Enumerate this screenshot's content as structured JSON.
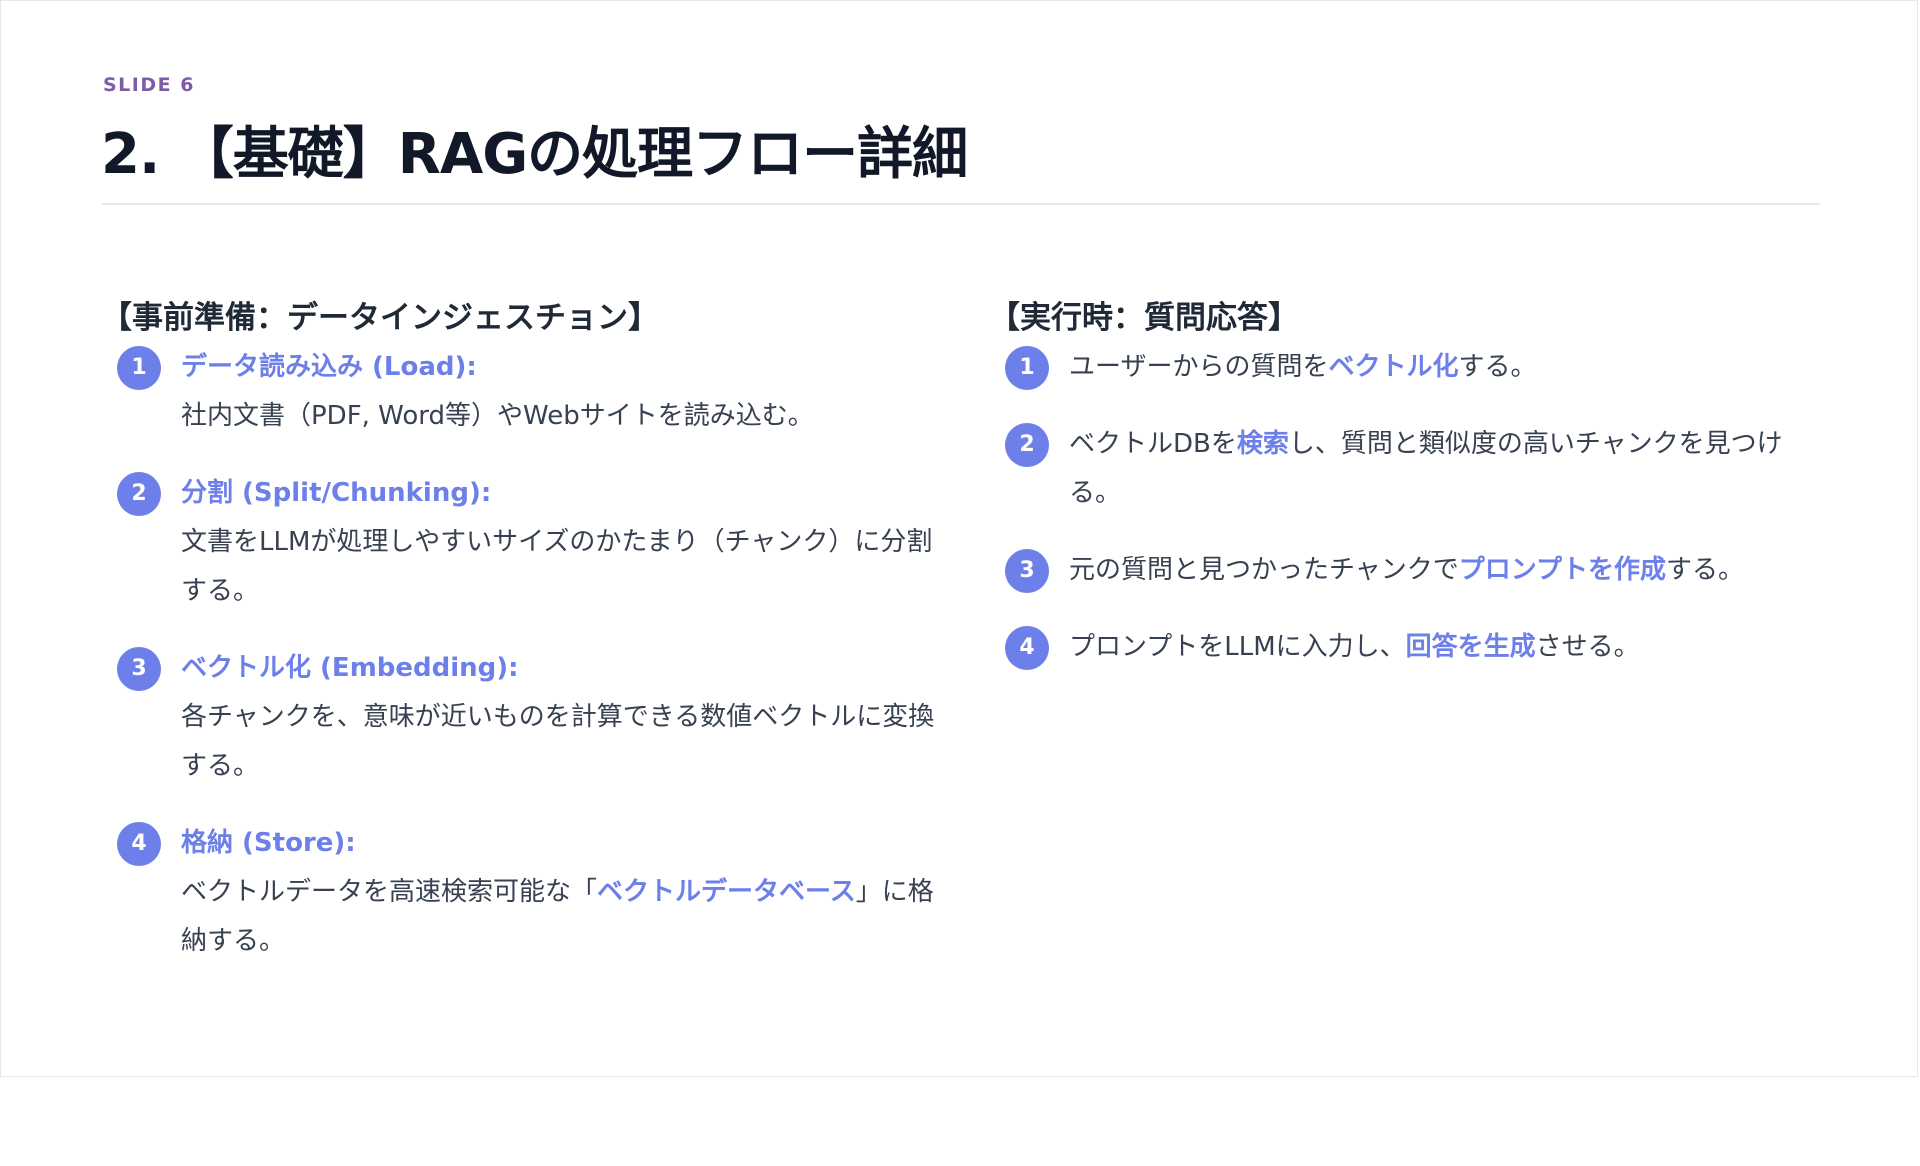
{
  "slide": {
    "label": "SLIDE 6",
    "title": "2. 【基礎】RAGの処理フロー詳細"
  },
  "left": {
    "heading": "【事前準備：データインジェスチョン】",
    "steps": [
      {
        "num": "1",
        "title": "データ読み込み (Load):",
        "desc": "社内文書（PDF, Word等）やWebサイトを読み込む。"
      },
      {
        "num": "2",
        "title": "分割 (Split/Chunking):",
        "desc": "文書をLLMが処理しやすいサイズのかたまり（チャンク）に分割する。"
      },
      {
        "num": "3",
        "title": "ベクトル化 (Embedding):",
        "desc": "各チャンクを、意味が近いものを計算できる数値ベクトルに変換する。"
      },
      {
        "num": "4",
        "title": "格納 (Store):",
        "desc_pre": "ベクトルデータを高速検索可能な「",
        "desc_hl": "ベクトルデータベース",
        "desc_post": "」に格納する。"
      }
    ]
  },
  "right": {
    "heading": "【実行時：質問応答】",
    "steps": [
      {
        "num": "1",
        "pre": "ユーザーからの質問を",
        "hl": "ベクトル化",
        "post": "する。"
      },
      {
        "num": "2",
        "pre": "ベクトルDBを",
        "hl": "検索",
        "post": "し、質問と類似度の高いチャンクを見つける。"
      },
      {
        "num": "3",
        "pre": "元の質問と見つかったチャンクで",
        "hl": "プロンプトを作成",
        "post": "する。"
      },
      {
        "num": "4",
        "pre": "プロンプトをLLMに入力し、",
        "hl": "回答を生成",
        "post": "させる。"
      }
    ]
  },
  "colors": {
    "accent": "#6d7fe8",
    "label": "#7e5aa8",
    "title": "#111827",
    "body": "#374151"
  }
}
